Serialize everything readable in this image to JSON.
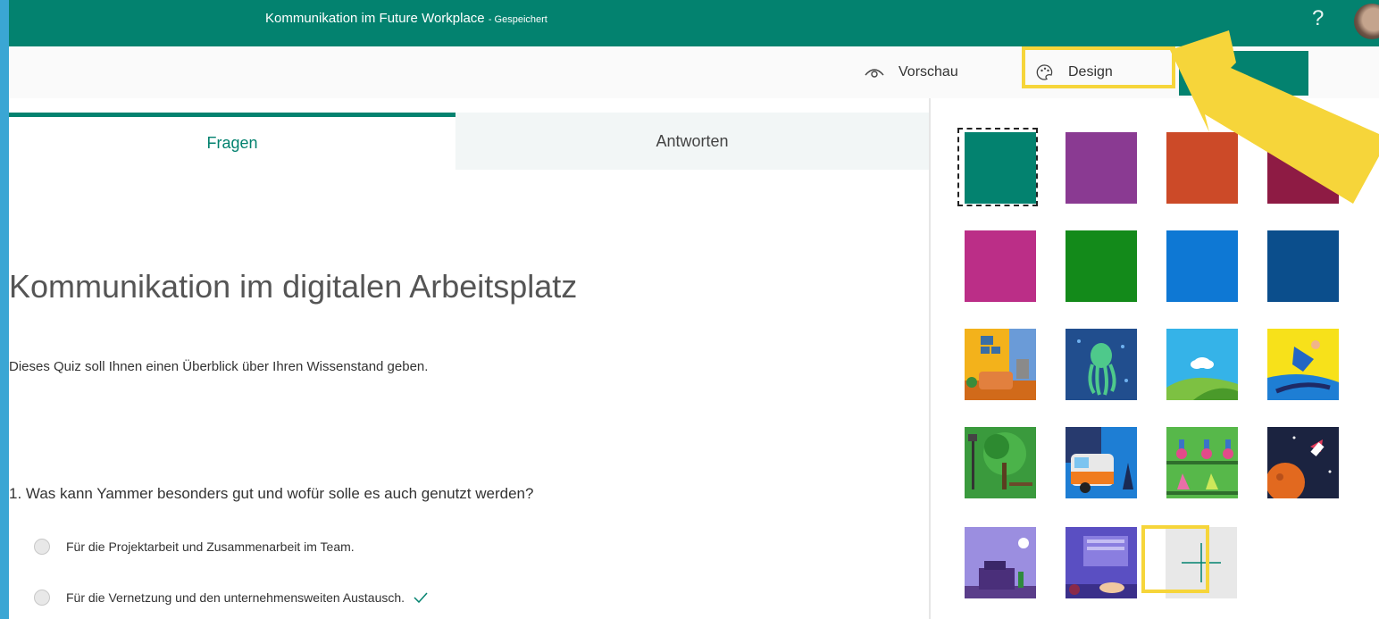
{
  "app": {
    "title": "Kommunikation im Future Workplace",
    "saved_status": "- Gespeichert",
    "help_label": "?"
  },
  "toolbar": {
    "preview_label": "Vorschau",
    "design_label": "Design",
    "more_label": "..."
  },
  "tabs": [
    {
      "label": "Fragen",
      "active": true
    },
    {
      "label": "Antworten",
      "active": false
    }
  ],
  "form": {
    "title": "Kommunikation im digitalen Arbeitsplatz",
    "description": "Dieses Quiz soll Ihnen einen Überblick über Ihren Wissenstand geben.",
    "question": {
      "text": "1. Was kann Yammer besonders gut und wofür solle es auch genutzt werden?",
      "options": [
        {
          "label": "Für die Projektarbeit und Zusammenarbeit im Team.",
          "correct": false
        },
        {
          "label": "Für die Vernetzung und den unternehmensweiten Austausch.",
          "correct": true
        }
      ]
    }
  },
  "themes": {
    "colors": [
      "#03826f",
      "#8a3a92",
      "#cc4a28",
      "#8e1b44",
      "#bb2e87",
      "#138a1a",
      "#0e78d4",
      "#0b4e8c"
    ],
    "images": [
      "living-room",
      "octopus",
      "cloud-hills",
      "snowboarder",
      "park-tree",
      "bus",
      "lab-shelves",
      "rocket-space",
      "desk-clock",
      "keyboard-hands"
    ],
    "selected_index": 0,
    "add_label": "+"
  },
  "colors": {
    "accent": "#03826f",
    "highlight": "#f6d53a",
    "frame": "#3aa6d4"
  }
}
